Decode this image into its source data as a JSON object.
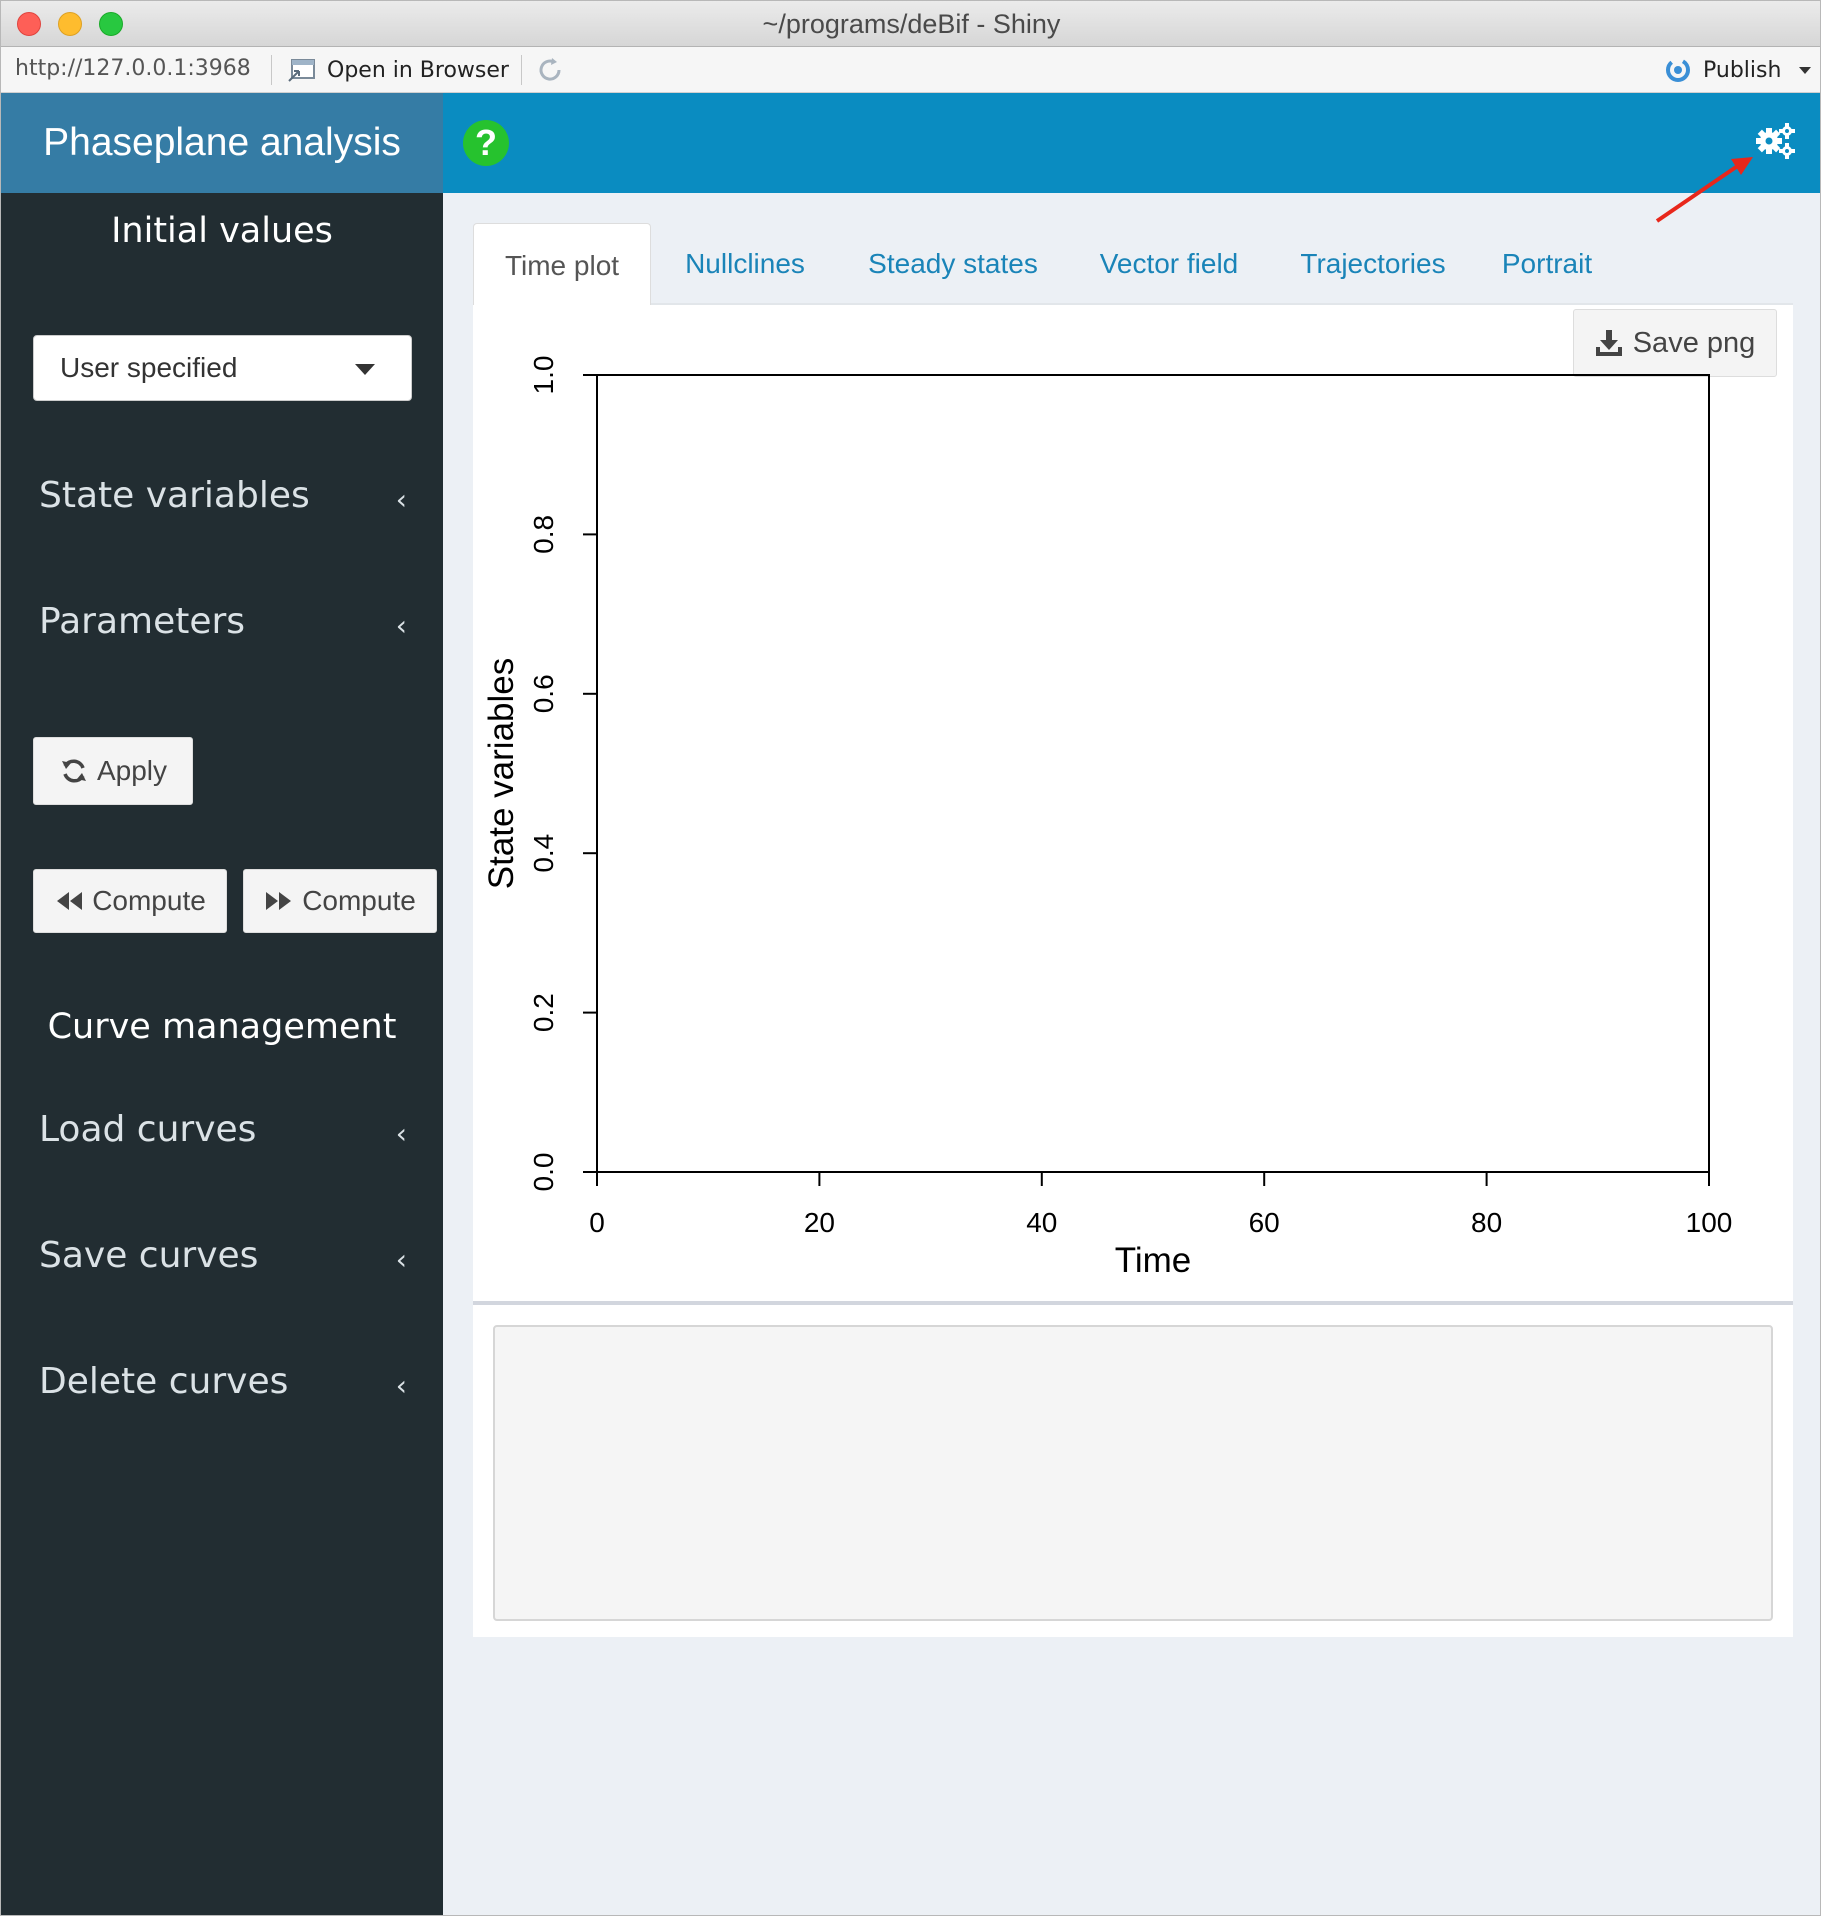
{
  "window": {
    "title": "~/programs/deBif - Shiny",
    "traffic_lights": {
      "close": "#fe5f57",
      "minimize": "#febc2e",
      "zoom": "#28c840"
    }
  },
  "browser_toolbar": {
    "url": "http://127.0.0.1:3968",
    "open_in_browser": "Open in Browser",
    "publish": "Publish"
  },
  "header": {
    "logo": "Phaseplane analysis",
    "help_glyph": "?",
    "gear_icon": "gears-icon",
    "colors": {
      "logo_bg": "#357ca5",
      "navbar_bg": "#0a8cc1",
      "help": "#26c22e"
    }
  },
  "sidebar": {
    "initial_values_heading": "Initial values",
    "select_value": "User specified",
    "menu": [
      {
        "label": "State variables"
      },
      {
        "label": "Parameters"
      }
    ],
    "apply_label": "Apply",
    "compute_backward_label": "Compute",
    "compute_forward_label": "Compute",
    "curve_management_heading": "Curve management",
    "curve_menu": [
      {
        "label": "Load curves"
      },
      {
        "label": "Save curves"
      },
      {
        "label": "Delete curves"
      }
    ]
  },
  "tabs": [
    {
      "label": "Time plot",
      "active": true
    },
    {
      "label": "Nullclines"
    },
    {
      "label": "Steady states"
    },
    {
      "label": "Vector field"
    },
    {
      "label": "Trajectories"
    },
    {
      "label": "Portrait"
    }
  ],
  "plot": {
    "save_png_label": "Save png"
  },
  "chart_data": {
    "type": "line",
    "title": "",
    "xlabel": "Time",
    "ylabel": "State variables",
    "xlim": [
      0,
      100
    ],
    "ylim": [
      0,
      1
    ],
    "xticks": [
      0,
      20,
      40,
      60,
      80,
      100
    ],
    "yticks": [
      0.0,
      0.2,
      0.4,
      0.6,
      0.8,
      1.0
    ],
    "ytick_labels": [
      "0.0",
      "0.2",
      "0.4",
      "0.6",
      "0.8",
      "1.0"
    ],
    "series": [],
    "grid": false,
    "legend": "none"
  }
}
